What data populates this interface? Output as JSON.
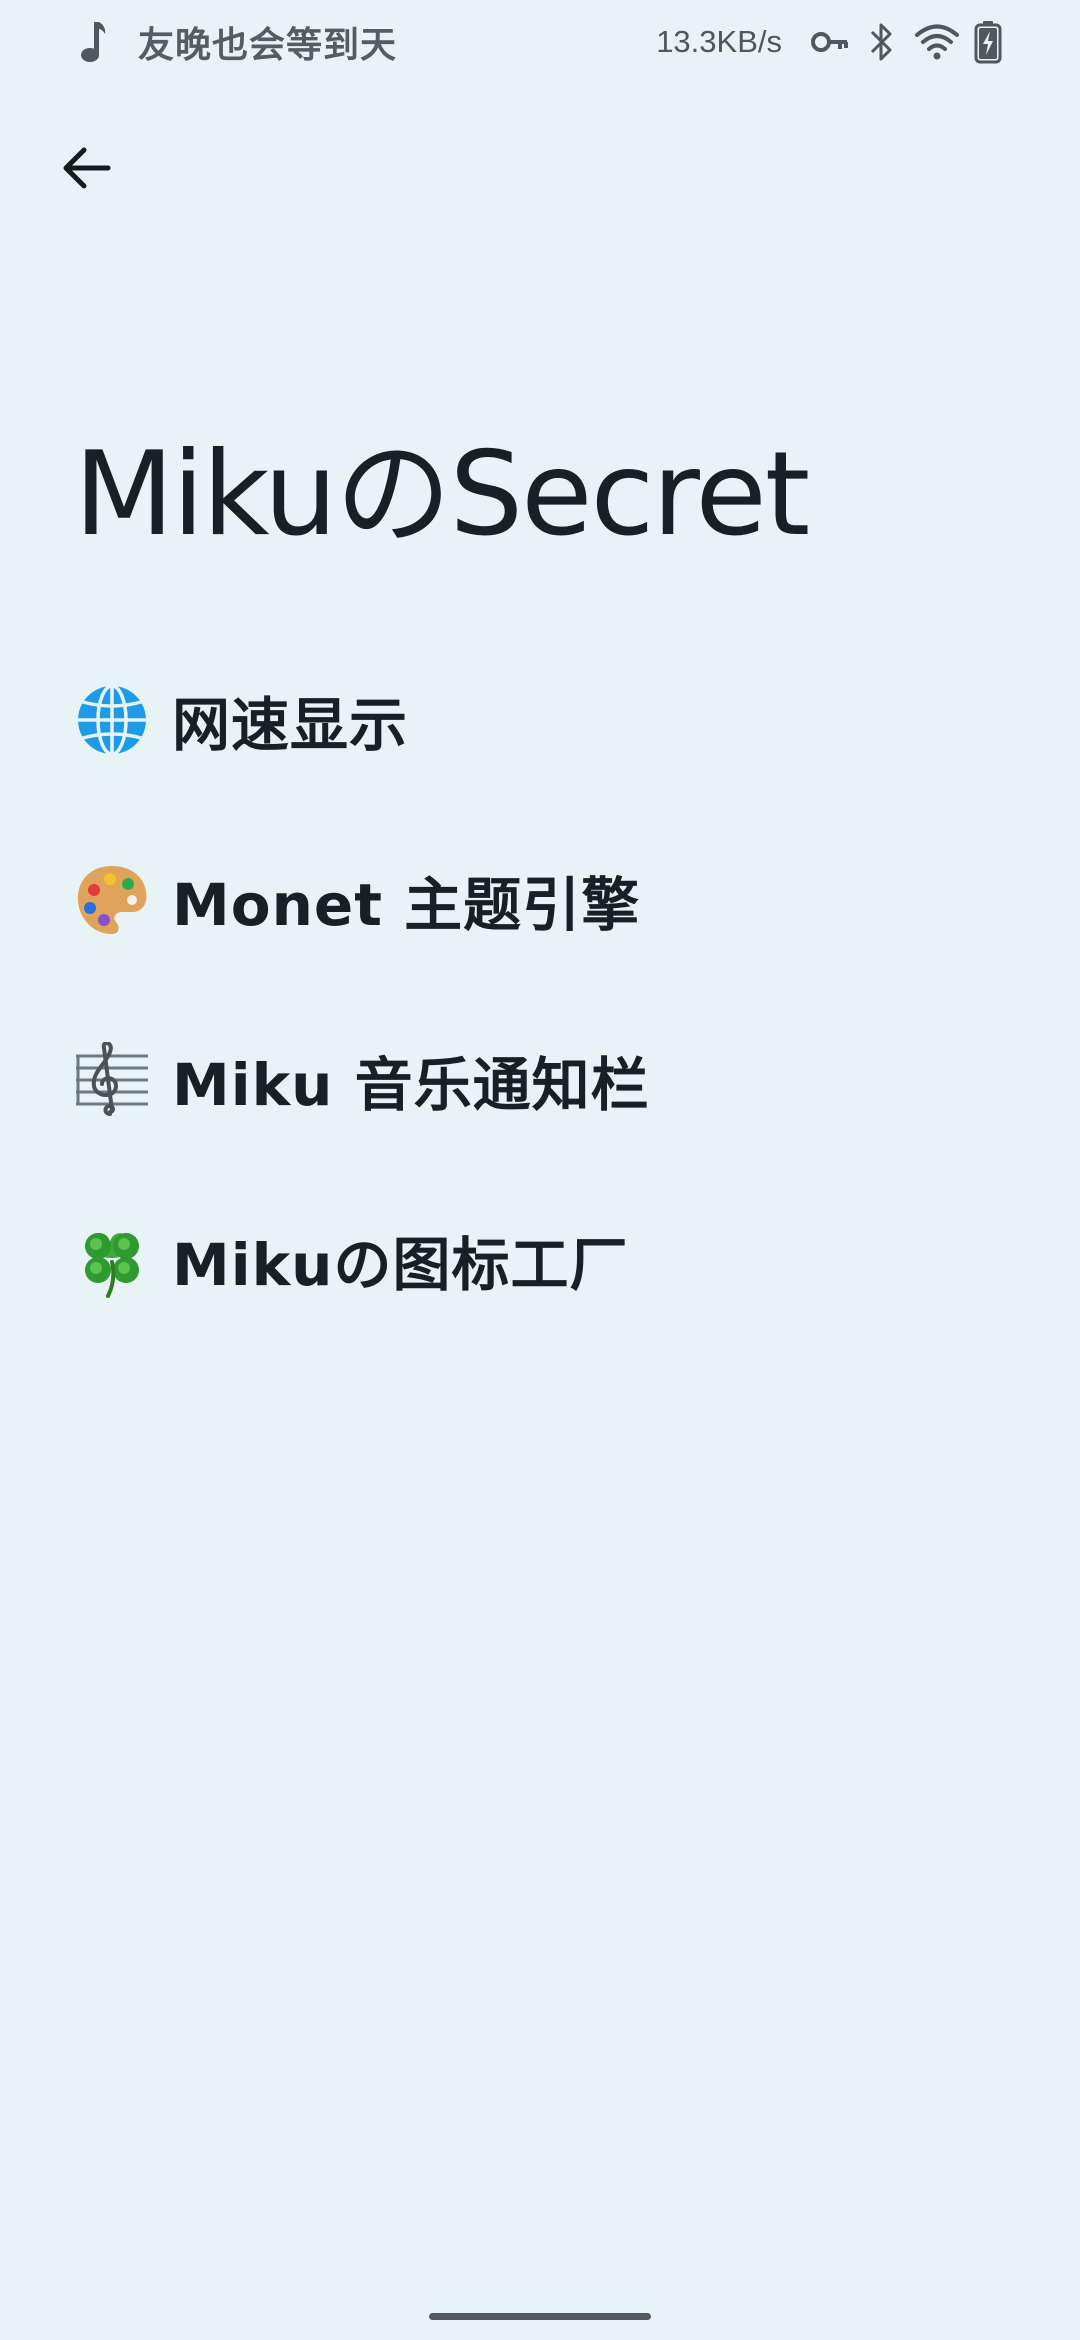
{
  "status_bar": {
    "music_icon": "music-note-icon",
    "song_title": "友晚也会等到天",
    "net_speed": "13.3KB/s",
    "icons": [
      "vpn-key-icon",
      "bluetooth-icon",
      "wifi-icon",
      "battery-charging-icon"
    ]
  },
  "header": {
    "back_icon": "arrow-left-icon"
  },
  "page": {
    "title": "MikuのSecret"
  },
  "menu": {
    "items": [
      {
        "emoji": "globe-icon",
        "label": "网速显示"
      },
      {
        "emoji": "artist-palette-icon",
        "label": "Monet 主题引擎"
      },
      {
        "emoji": "musical-score-icon",
        "label": "Miku 音乐通知栏"
      },
      {
        "emoji": "four-leaf-clover-icon",
        "label": "Mikuの图标工厂"
      }
    ]
  },
  "colors": {
    "background": "#e8f3f5",
    "text_primary": "#172022",
    "status_text": "#545d60"
  }
}
